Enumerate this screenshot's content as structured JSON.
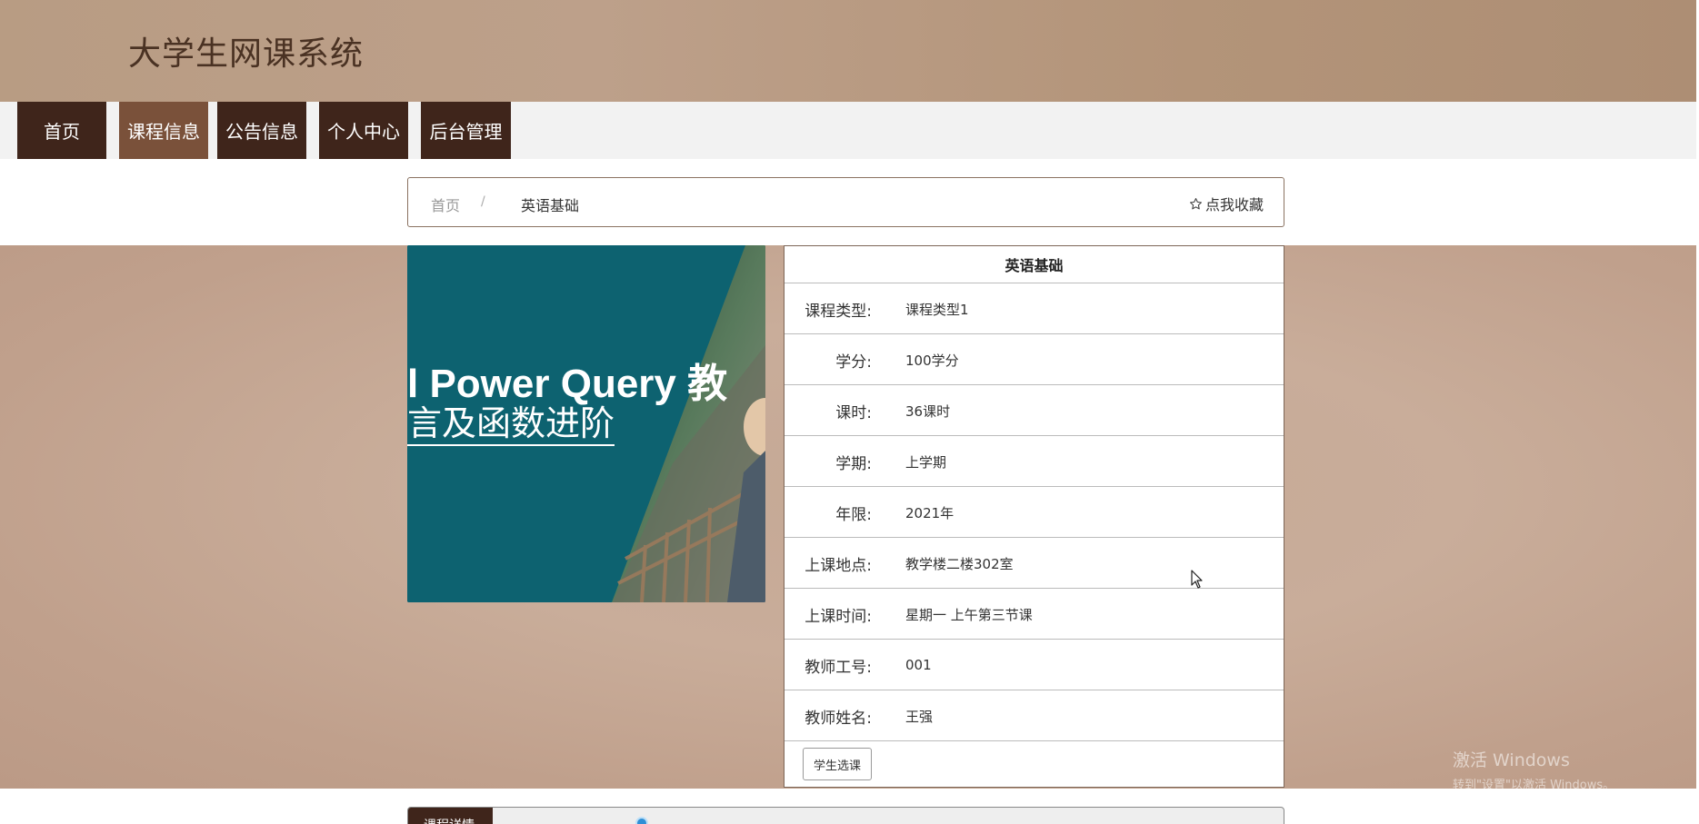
{
  "site": {
    "title": "大学生网课系统"
  },
  "nav": {
    "items": [
      {
        "label": "首页"
      },
      {
        "label": "课程信息"
      },
      {
        "label": "公告信息"
      },
      {
        "label": "个人中心"
      },
      {
        "label": "后台管理"
      }
    ]
  },
  "breadcrumb": {
    "home": "首页",
    "separator": "/",
    "current": "英语基础",
    "favorite": "点我收藏"
  },
  "course_image": {
    "line1": "l Power Query 教",
    "line2": "言及函数进阶"
  },
  "details": {
    "title": "英语基础",
    "rows": [
      {
        "label": "课程类型:",
        "value": "课程类型1"
      },
      {
        "label": "学分:",
        "value": "100学分"
      },
      {
        "label": "课时:",
        "value": "36课时"
      },
      {
        "label": "学期:",
        "value": "上学期"
      },
      {
        "label": "年限:",
        "value": "2021年"
      },
      {
        "label": "上课地点:",
        "value": "教学楼二楼302室"
      },
      {
        "label": "上课时间:",
        "value": "星期一 上午第三节课"
      },
      {
        "label": "教师工号:",
        "value": "001"
      },
      {
        "label": "教师姓名:",
        "value": "王强"
      }
    ],
    "enroll_button": "学生选课"
  },
  "bottom": {
    "tab_label": "课程详情"
  },
  "watermark": {
    "line1": "激活 Windows",
    "line2": "转到\"设置\"以激活 Windows。"
  },
  "colors": {
    "nav_bg": "#3f251b",
    "nav_active": "#7a513a",
    "image_teal": "#0d6270"
  }
}
